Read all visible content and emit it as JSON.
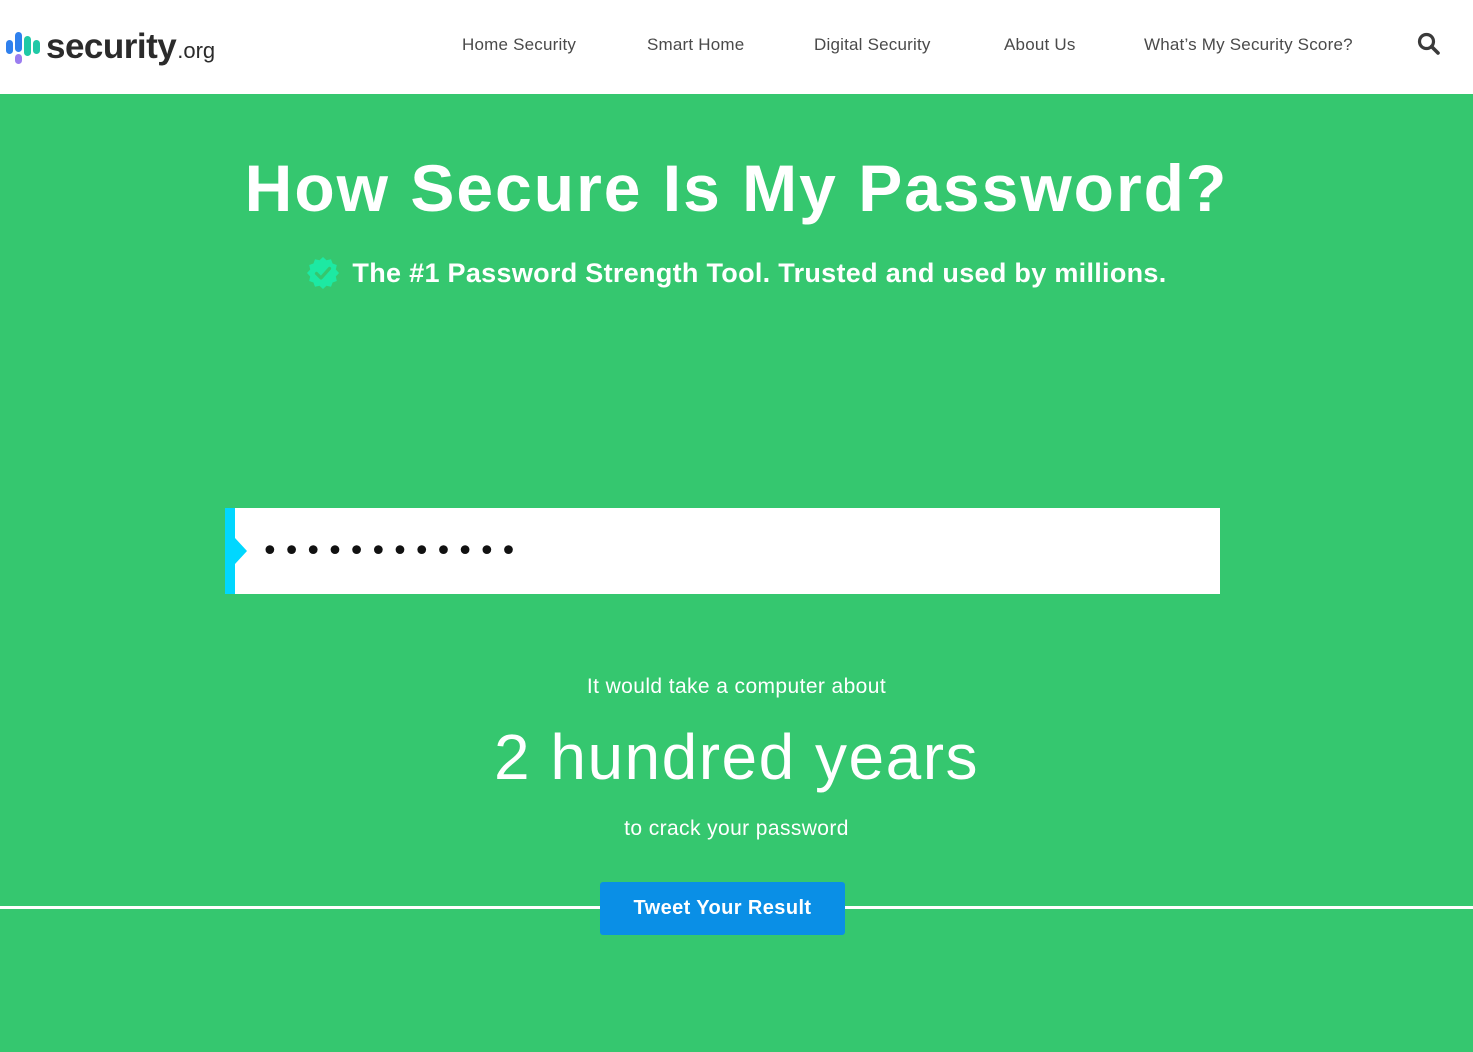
{
  "header": {
    "logo": {
      "word": "security",
      "tld": ".org"
    },
    "nav": [
      {
        "label": "Home Security"
      },
      {
        "label": "Smart Home"
      },
      {
        "label": "Digital Security"
      },
      {
        "label": "About Us"
      },
      {
        "label": "What’s My Security Score?"
      }
    ],
    "search_icon": "search-icon"
  },
  "hero": {
    "title": "How Secure Is My Password?",
    "subtitle": "The #1 Password Strength Tool. Trusted and used by millions.",
    "badge_icon": "verified-check-icon"
  },
  "password_field": {
    "value": "examplepass1",
    "masked": true
  },
  "result": {
    "pre_text": "It would take a computer about",
    "time": "2 hundred years",
    "post_text": "to crack your password"
  },
  "tweet_button": {
    "label": "Tweet Your Result"
  },
  "colors": {
    "background": "#35c76f",
    "accent": "#00d7ff",
    "button": "#0a8fe6",
    "badge": "#1de9a3"
  }
}
